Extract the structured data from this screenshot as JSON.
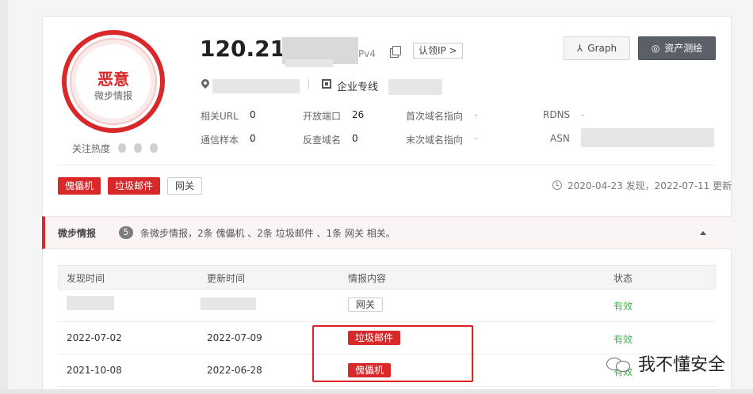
{
  "threat": {
    "verdict": "恶意",
    "source": "微步情报",
    "heat_label": "关注热度"
  },
  "header": {
    "ip": "120.211",
    "ip_version": "Pv4",
    "claim_ip": "认领IP >",
    "org": "企业专线",
    "graph_button": "Graph",
    "assets_button": "资产测绘"
  },
  "stats": {
    "related_url_label": "相关URL",
    "related_url_value": "0",
    "open_ports_label": "开放端口",
    "open_ports_value": "26",
    "first_domain_label": "首次域名指向",
    "first_domain_value": "-",
    "rdns_label": "RDNS",
    "rdns_value": "-",
    "comm_samples_label": "通信样本",
    "comm_samples_value": "0",
    "reverse_domains_label": "反查域名",
    "reverse_domains_value": "0",
    "last_domain_label": "末次域名指向",
    "last_domain_value": "-",
    "asn_label": "ASN"
  },
  "tags": [
    "傀儡机",
    "垃圾邮件",
    "网关"
  ],
  "dates": "2020-04-23 发现，2022-07-11 更新",
  "intel": {
    "title": "微步情报",
    "count": "5",
    "summary": "条微步情报，2条 傀儡机 、2条 垃圾邮件 、1条 网关 相关。"
  },
  "table": {
    "columns": [
      "发现时间",
      "更新时间",
      "情报内容",
      "状态"
    ],
    "rows": [
      {
        "found": "",
        "updated": "",
        "tag": "网关",
        "status": "有效"
      },
      {
        "found": "2022-07-02",
        "updated": "2022-07-09",
        "tag": "垃圾邮件",
        "status": "有效"
      },
      {
        "found": "2021-10-08",
        "updated": "2022-06-28",
        "tag": "傀儡机",
        "status": "有效"
      }
    ]
  },
  "watermark": "我不懂安全",
  "colors": {
    "accent_red": "#d8282a",
    "valid_green": "#3bb54a",
    "highlight_red": "#e02020"
  }
}
